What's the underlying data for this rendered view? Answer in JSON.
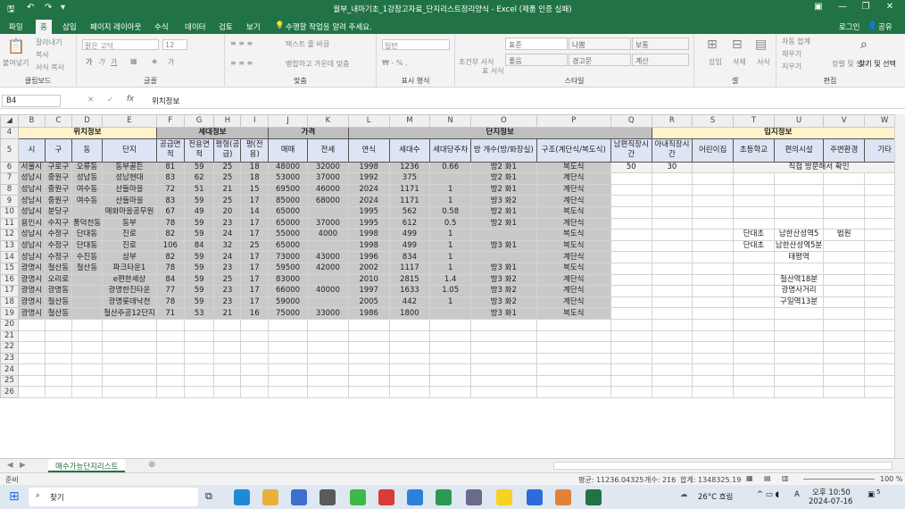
{
  "window": {
    "title": "월부_내마기초_1강참고자료_단지리스트정리양식 - Excel (제품 인증 실패)",
    "signin": "로그인",
    "share": "공유",
    "minimize_icon": "minimize-icon",
    "colors": {
      "excel_green": "#217346"
    }
  },
  "ribbon_tabs": [
    "파일",
    "홈",
    "삽입",
    "페이지 레이아웃",
    "수식",
    "데이터",
    "검토",
    "보기"
  ],
  "tell_me": "수행할 작업을 알려 주세요.",
  "ribbon": {
    "clipboard": {
      "paste": "붙여넣기",
      "cut": "잘라내기",
      "copy": "복사",
      "format_painter": "서식 복사",
      "label": "클립보드"
    },
    "font": {
      "font_name": "맑은 고딕",
      "font_size": "12",
      "label": "글꼴"
    },
    "alignment": {
      "wrap": "텍스트 줄 바꿈",
      "merge": "병합하고 가운데 맞춤",
      "label": "맞춤"
    },
    "number": {
      "format": "일반",
      "label": "표시 형식"
    },
    "styles": {
      "conditional": "조건부 서식",
      "table": "표 서식",
      "normal": "표준",
      "bad": "나쁨",
      "good": "보통",
      "neutral": "좋음",
      "warning": "경고문",
      "calc": "계산",
      "label": "스타일"
    },
    "cells": {
      "insert": "삽입",
      "delete": "삭제",
      "format": "서식",
      "label": "셀"
    },
    "editing": {
      "autosum": "자동 합계",
      "fill": "채우기",
      "clear": "지우기",
      "sort": "정렬 및 필터",
      "find": "찾기 및 선택",
      "label": "편집"
    }
  },
  "formula_bar": {
    "name_box": "B4",
    "formula": "위치정보"
  },
  "columns": [
    "B",
    "C",
    "D",
    "E",
    "F",
    "G",
    "H",
    "I",
    "J",
    "K",
    "L",
    "M",
    "N",
    "O",
    "P",
    "Q",
    "R",
    "S",
    "T",
    "U",
    "V",
    "W"
  ],
  "headers": {
    "group_location": "위치정보",
    "group_unit": "세대정보",
    "group_price": "가격",
    "group_complex": "단지정보",
    "group_site": "입지정보",
    "sub": [
      "시",
      "구",
      "동",
      "단지",
      "공급면적",
      "전용면적",
      "평형(공급)",
      "평(전용)",
      "매매",
      "전세",
      "연식",
      "세대수",
      "세대당주차",
      "방 개수(방/화장실)",
      "구조(계단식/복도식)",
      "남편직장시간",
      "아내직장시간",
      "어린이집",
      "초등학교",
      "편의시설",
      "주변환경",
      "기타"
    ]
  },
  "rows": [
    {
      "n": "6",
      "c": [
        "서울시",
        "구로구",
        "오류동",
        "동부골든",
        "81",
        "59",
        "25",
        "18",
        "48000",
        "32000",
        "1998",
        "1236",
        "0.66",
        "방2 화1",
        "복도식",
        "50",
        "30",
        "",
        "직접 방문해서 확인",
        "",
        "",
        ""
      ]
    },
    {
      "n": "7",
      "c": [
        "성남시",
        "중원구",
        "성남동",
        "성남현대",
        "83",
        "62",
        "25",
        "18",
        "53000",
        "37000",
        "1992",
        "375",
        "",
        "방2 화1",
        "계단식",
        "",
        "",
        "",
        "",
        "",
        "",
        ""
      ]
    },
    {
      "n": "8",
      "c": [
        "성남시",
        "중원구",
        "여수동",
        "산들마을",
        "72",
        "51",
        "21",
        "15",
        "69500",
        "46000",
        "2024",
        "1171",
        "1",
        "방2 화1",
        "계단식",
        "",
        "",
        "",
        "",
        "",
        "",
        ""
      ]
    },
    {
      "n": "9",
      "c": [
        "성남시",
        "중원구",
        "여수동",
        "산들마을",
        "83",
        "59",
        "25",
        "17",
        "85000",
        "68000",
        "2024",
        "1171",
        "1",
        "방3 화2",
        "계단식",
        "",
        "",
        "",
        "",
        "",
        "",
        ""
      ]
    },
    {
      "n": "10",
      "c": [
        "성남시",
        "분당구",
        "",
        "매화마을공무원",
        "67",
        "49",
        "20",
        "14",
        "65000",
        "",
        "1995",
        "562",
        "0.58",
        "방2 화1",
        "복도식",
        "",
        "",
        "",
        "",
        "",
        "",
        ""
      ]
    },
    {
      "n": "11",
      "c": [
        "용인시",
        "수지구",
        "풍덕천동",
        "동부",
        "78",
        "59",
        "23",
        "17",
        "65000",
        "37000",
        "1995",
        "612",
        "0.5",
        "방2 화1",
        "계단식",
        "",
        "",
        "",
        "",
        "",
        "",
        ""
      ]
    },
    {
      "n": "12",
      "c": [
        "성남시",
        "수정구",
        "단대동",
        "진로",
        "82",
        "59",
        "24",
        "17",
        "55000",
        "4000",
        "1998",
        "499",
        "1",
        "",
        "복도식",
        "",
        "",
        "",
        "단대초",
        "남한산성역5",
        "법원",
        ""
      ]
    },
    {
      "n": "13",
      "c": [
        "성남시",
        "수정구",
        "단대동",
        "진로",
        "106",
        "84",
        "32",
        "25",
        "65000",
        "",
        "1998",
        "499",
        "1",
        "방3 화1",
        "복도식",
        "",
        "",
        "",
        "단대초",
        "남한산성역5분",
        "",
        ""
      ]
    },
    {
      "n": "14",
      "c": [
        "성남시",
        "수정구",
        "수진동",
        "삼부",
        "82",
        "59",
        "24",
        "17",
        "73000",
        "43000",
        "1996",
        "834",
        "1",
        "",
        "계단식",
        "",
        "",
        "",
        "",
        "태평역",
        "",
        ""
      ]
    },
    {
      "n": "15",
      "c": [
        "광명시",
        "철산동",
        "철산동",
        "파크타운1",
        "78",
        "59",
        "23",
        "17",
        "59500",
        "42000",
        "2002",
        "1117",
        "1",
        "방3 화1",
        "복도식",
        "",
        "",
        "",
        "",
        "",
        "",
        ""
      ]
    },
    {
      "n": "16",
      "c": [
        "광명시",
        "오리로",
        "",
        "e편한세상",
        "84",
        "59",
        "25",
        "17",
        "83000",
        "",
        "2010",
        "2815",
        "1.4",
        "방3 화2",
        "계단식",
        "",
        "",
        "",
        "",
        "철산역18분",
        "",
        ""
      ]
    },
    {
      "n": "17",
      "c": [
        "광명시",
        "광명동",
        "",
        "광명한진타운",
        "77",
        "59",
        "23",
        "17",
        "66000",
        "40000",
        "1997",
        "1633",
        "1.05",
        "방3 화2",
        "계단식",
        "",
        "",
        "",
        "",
        "광명사거리",
        "",
        ""
      ]
    },
    {
      "n": "18",
      "c": [
        "광명시",
        "철산동",
        "",
        "광명롯데낙천",
        "78",
        "59",
        "23",
        "17",
        "59000",
        "",
        "2005",
        "442",
        "1",
        "방3 화2",
        "계단식",
        "",
        "",
        "",
        "",
        "구일역13분",
        "",
        ""
      ]
    },
    {
      "n": "19",
      "c": [
        "광명시",
        "철산동",
        "",
        "철산주공12단지",
        "71",
        "53",
        "21",
        "16",
        "75000",
        "33000",
        "1986",
        "1800",
        "",
        "방3 화1",
        "복도식",
        "",
        "",
        "",
        "",
        "",
        "",
        ""
      ]
    }
  ],
  "empty_rows": [
    "20",
    "21",
    "22",
    "23",
    "24",
    "25",
    "26"
  ],
  "sheet_tab": "매수가능단지리스트",
  "status": {
    "ready": "준비",
    "average": "평균: 11236.04325",
    "count": "개수: 216",
    "sum": "합계: 1348325.19",
    "zoom": "100 %"
  },
  "taskbar": {
    "search": "찾기",
    "weather": "26°C 흐림",
    "ime": "A",
    "time": "오후 10:50",
    "date": "2024-07-16",
    "notif": "5"
  }
}
